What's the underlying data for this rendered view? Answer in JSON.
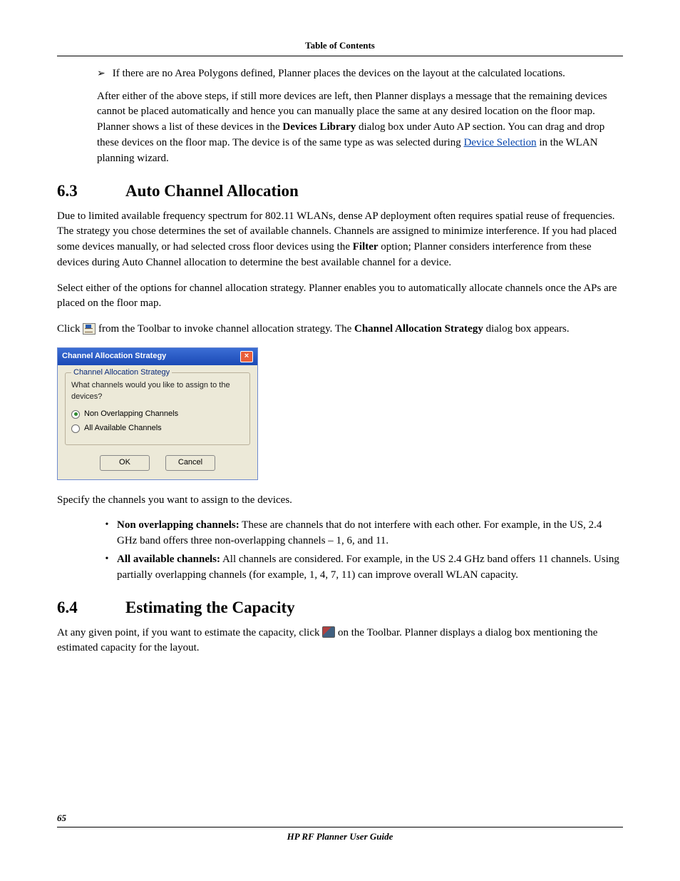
{
  "header": {
    "toc": "Table of Contents"
  },
  "intro": {
    "arrow_item": "If there are no Area Polygons defined, Planner places the devices on the layout at the calculated locations.",
    "para_a": "After either of the above steps, if still more devices are left, then Planner displays a message that the remaining devices cannot be placed automatically and hence you can manually place the same at any desired location on the floor map. Planner shows a list of these devices in the ",
    "devices_library": "Devices Library",
    "para_b": " dialog box under Auto AP section. You can drag and drop these devices on the floor map. The device is of the same type as was selected during ",
    "link": "Device Selection",
    "para_c": " in the WLAN planning wizard."
  },
  "sec63": {
    "num": "6.3",
    "title": "Auto Channel Allocation",
    "p1a": "Due to limited available frequency spectrum for 802.11 WLANs, dense AP deployment often requires spatial reuse of frequencies. The strategy you chose determines the set of available channels. Channels are assigned to minimize interference. If you had placed some devices manually, or had selected cross floor devices using the ",
    "filter": "Filter",
    "p1b": " option; Planner considers interference from these devices during Auto Channel allocation to determine the best available channel for a device.",
    "p2": "Select either of the options for channel allocation strategy. Planner enables you to automatically allocate channels once the APs are placed on the floor map.",
    "p3a": "Click ",
    "p3b": " from the Toolbar to invoke channel allocation strategy. The ",
    "cas": "Channel Allocation Strategy",
    "p3c": " dialog box appears.",
    "specify": "Specify the channels you want to assign to the devices.",
    "b1_label": "Non overlapping channels:",
    "b1_text": " These are channels that do not interfere with each other. For example, in the US, 2.4 GHz band offers three non-overlapping channels – 1, 6, and 11.",
    "b2_label": "All available channels:",
    "b2_text": " All channels are considered. For example, in the US 2.4 GHz band offers 11 channels. Using partially overlapping channels (for example, 1, 4, 7, 11) can improve overall WLAN capacity."
  },
  "dialog": {
    "title": "Channel Allocation Strategy",
    "legend": "Channel Allocation Strategy",
    "question": "What channels would you like to assign to the devices?",
    "opt1": "Non Overlapping Channels",
    "opt2": "All Available Channels",
    "ok": "OK",
    "cancel": "Cancel"
  },
  "sec64": {
    "num": "6.4",
    "title": "Estimating the Capacity",
    "p1a": "At any given point, if you want to estimate the capacity, click ",
    "p1b": " on the Toolbar. Planner displays a dialog box mentioning the estimated capacity for the layout."
  },
  "footer": {
    "page": "65",
    "title": "HP RF Planner User Guide"
  }
}
